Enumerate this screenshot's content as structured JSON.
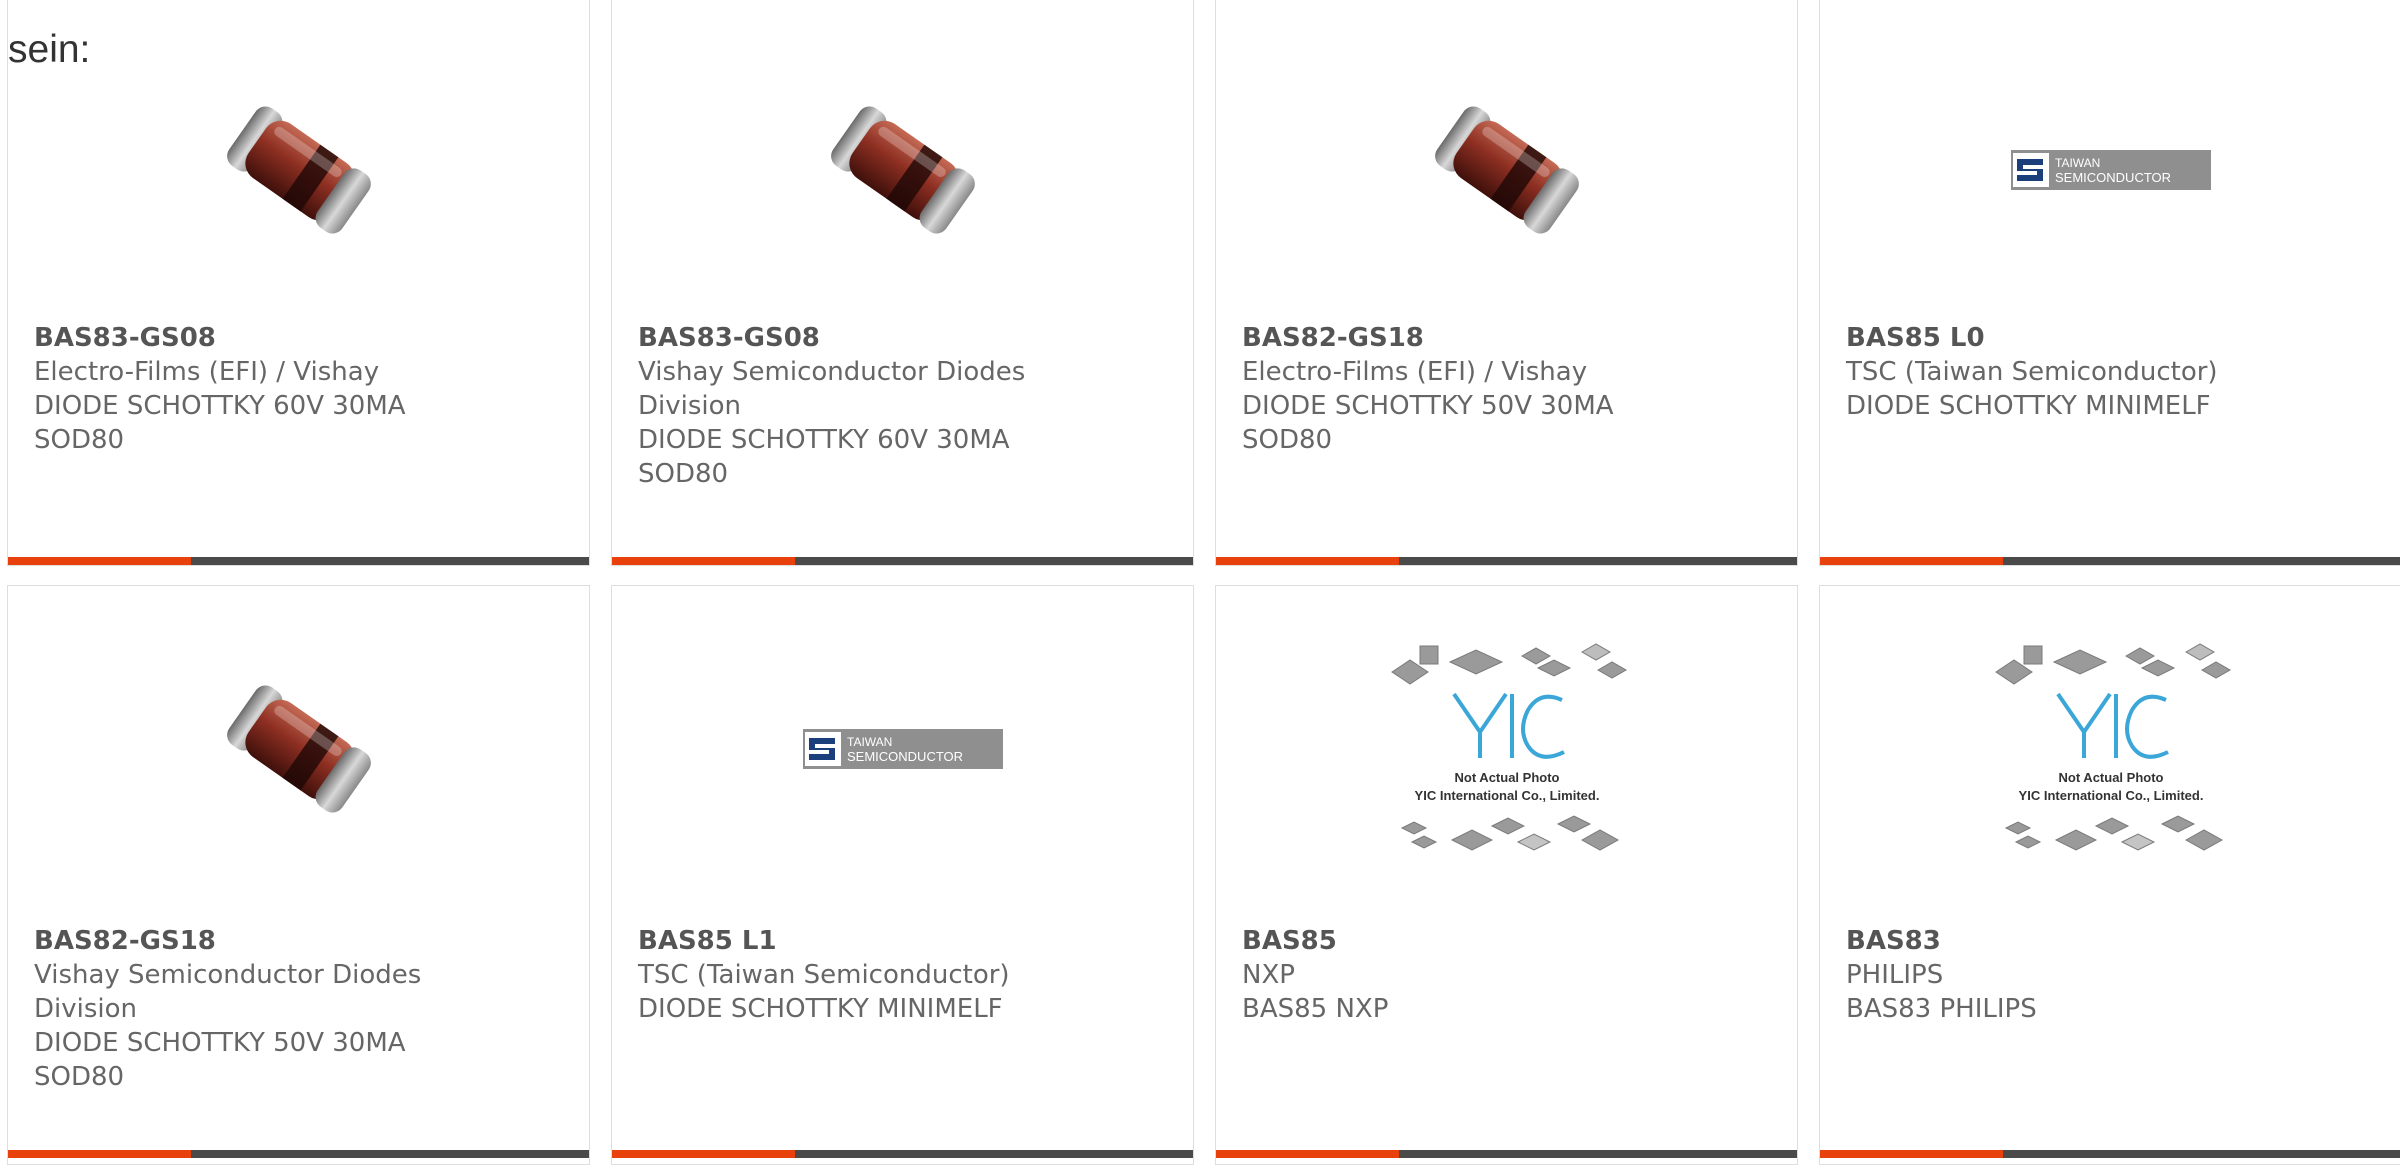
{
  "intro_text": "sein:",
  "colors": {
    "accent": "#e8410c",
    "bar": "#4a4a4a",
    "border": "#dedede",
    "text": "#666666"
  },
  "cards": [
    {
      "part_number": "BAS83-GS08",
      "manufacturer": "Electro-Films (EFI) / Vishay",
      "desc1": "DIODE SCHOTTKY 60V 30MA",
      "desc2": "SOD80",
      "image": "diode-photo"
    },
    {
      "part_number": "BAS83-GS08",
      "manufacturer": "Vishay Semiconductor Diodes Division",
      "desc1": "DIODE SCHOTTKY 60V 30MA",
      "desc2": "SOD80",
      "image": "diode-photo"
    },
    {
      "part_number": "BAS82-GS18",
      "manufacturer": "Electro-Films (EFI) / Vishay",
      "desc1": "DIODE SCHOTTKY 50V 30MA",
      "desc2": "SOD80",
      "image": "diode-photo"
    },
    {
      "part_number": "BAS85 L0",
      "manufacturer": "TSC (Taiwan Semiconductor)",
      "desc1": "DIODE SCHOTTKY MINIMELF",
      "desc2": "",
      "image": "taiwan-semiconductor-logo",
      "logo_text": [
        "TAIWAN",
        "SEMICONDUCTOR"
      ]
    },
    {
      "part_number": "BAS82-GS18",
      "manufacturer": "Vishay Semiconductor Diodes Division",
      "desc1": "DIODE SCHOTTKY 50V 30MA",
      "desc2": "SOD80",
      "image": "diode-photo"
    },
    {
      "part_number": "BAS85 L1",
      "manufacturer": "TSC (Taiwan Semiconductor)",
      "desc1": "DIODE SCHOTTKY MINIMELF",
      "desc2": "",
      "image": "taiwan-semiconductor-logo",
      "logo_text": [
        "TAIWAN",
        "SEMICONDUCTOR"
      ]
    },
    {
      "part_number": "BAS85",
      "manufacturer": "NXP",
      "desc1": "BAS85 NXP",
      "desc2": "",
      "image": "yic-placeholder",
      "placeholder_text": [
        "Not Actual Photo",
        "YIC International Co., Limited."
      ]
    },
    {
      "part_number": "BAS83",
      "manufacturer": "PHILIPS",
      "desc1": "BAS83 PHILIPS",
      "desc2": "",
      "image": "yic-placeholder",
      "placeholder_text": [
        "Not Actual Photo",
        "YIC International Co., Limited."
      ]
    }
  ]
}
